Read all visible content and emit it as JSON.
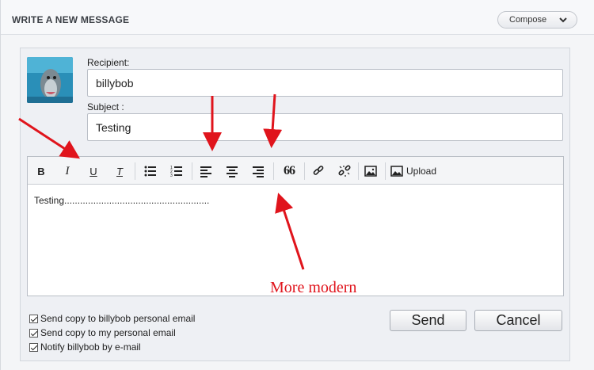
{
  "header": {
    "title": "WRITE A NEW MESSAGE",
    "compose_label": "Compose"
  },
  "form": {
    "recipient_label": "Recipient:",
    "recipient_value": "billybob",
    "subject_label": "Subject :",
    "subject_value": "Testing"
  },
  "toolbar": {
    "items": [
      {
        "icon": "bold-icon",
        "glyph": "B"
      },
      {
        "icon": "italic-icon",
        "glyph": "I"
      },
      {
        "icon": "underline-icon",
        "glyph": "U"
      },
      {
        "icon": "clear-formatting-icon",
        "glyph": "T"
      },
      {
        "icon": "bulleted-list-icon"
      },
      {
        "icon": "numbered-list-icon"
      },
      {
        "icon": "align-left-icon"
      },
      {
        "icon": "align-center-icon"
      },
      {
        "icon": "align-right-icon"
      },
      {
        "icon": "quote-icon",
        "glyph": "66"
      },
      {
        "icon": "link-icon"
      },
      {
        "icon": "unlink-icon"
      },
      {
        "icon": "image-icon"
      },
      {
        "icon": "upload-image-icon"
      }
    ],
    "upload_label": "Upload"
  },
  "editor": {
    "content": "Testing......................................................."
  },
  "options": [
    {
      "label": "Send copy to billybob personal email",
      "checked": true
    },
    {
      "label": "Send copy to my personal email",
      "checked": true
    },
    {
      "label": "Notify billybob by e-mail",
      "checked": true
    }
  ],
  "buttons": {
    "send": "Send",
    "cancel": "Cancel"
  },
  "annotation": {
    "text": "More modern",
    "color": "#e0141c"
  }
}
